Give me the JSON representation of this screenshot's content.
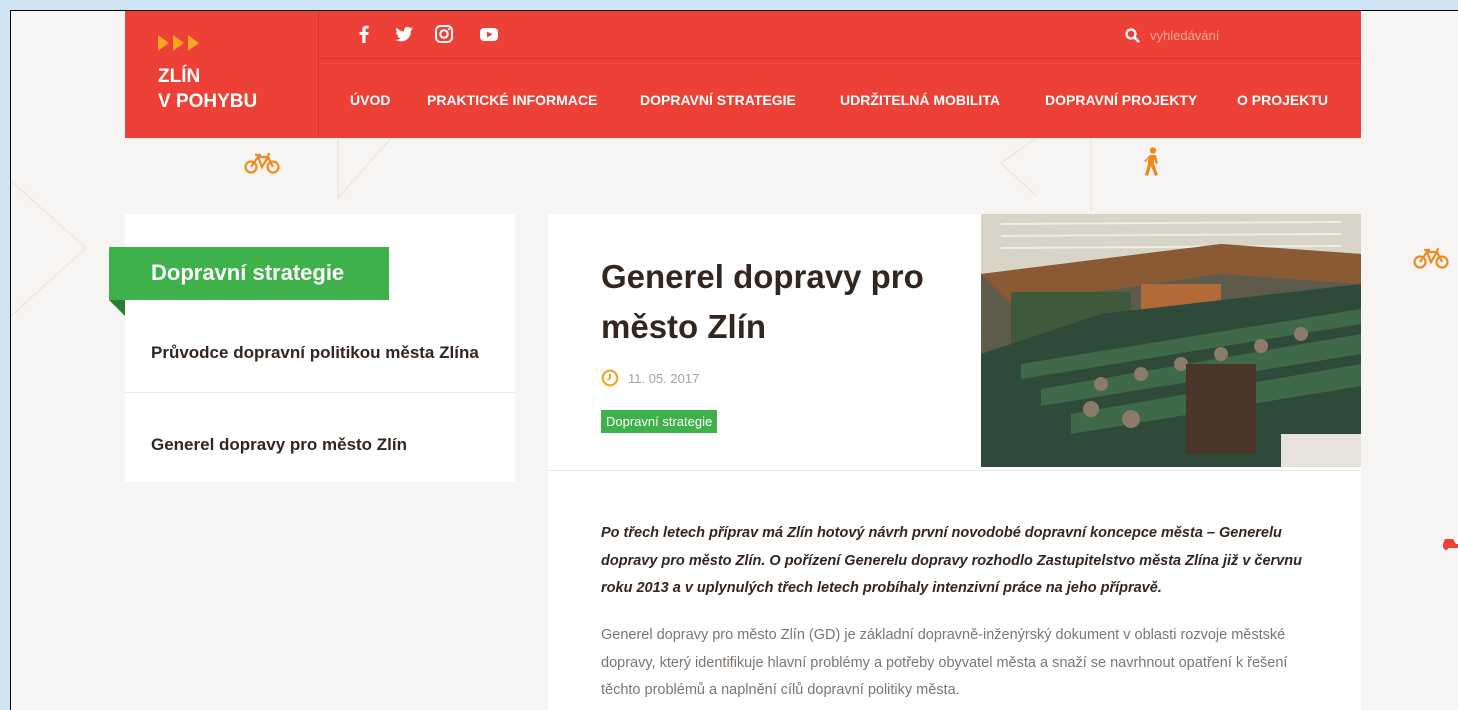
{
  "brand": {
    "logo_line1": "ZLÍN",
    "logo_line2": "V POHYBU",
    "accent": "#ed4036",
    "arrow_color": "#f5a623",
    "green": "#3fb14a"
  },
  "social": [
    "facebook-icon",
    "twitter-icon",
    "instagram-icon",
    "youtube-icon"
  ],
  "search": {
    "placeholder": "vyhledávání"
  },
  "nav": {
    "items": [
      {
        "label": "ÚVOD"
      },
      {
        "label": "PRAKTICKÉ INFORMACE"
      },
      {
        "label": "DOPRAVNÍ STRATEGIE"
      },
      {
        "label": "UDRŽITELNÁ MOBILITA"
      },
      {
        "label": "DOPRAVNÍ PROJEKTY"
      },
      {
        "label": "O PROJEKTU"
      }
    ]
  },
  "sidebar": {
    "title": "Dopravní strategie",
    "items": [
      {
        "label": "Průvodce dopravní politikou města Zlína"
      },
      {
        "label": "Generel dopravy pro město Zlín"
      }
    ]
  },
  "article": {
    "title": "Generel dopravy pro město Zlín",
    "date": "11. 05. 2017",
    "tag": "Dopravní strategie",
    "lead": "Po třech letech příprav má Zlín hotový návrh první novodobé dopravní koncepce města – Generelu dopravy pro město Zlín. O pořízení Generelu dopravy rozhodlo Zastupitelstvo města Zlína již v červnu roku 2013 a v uplynulých třech letech probíhaly intenzivní práce na jeho přípravě.",
    "body": "Generel dopravy pro město Zlín (GD) je základní dopravně-inženýrský dokument v oblasti rozvoje městské dopravy, který identifikuje hlavní problémy a potřeby obyvatel města a snaží se navrhnout opatření k  řešení těchto problémů a naplnění cílů dopravní politiky města."
  }
}
